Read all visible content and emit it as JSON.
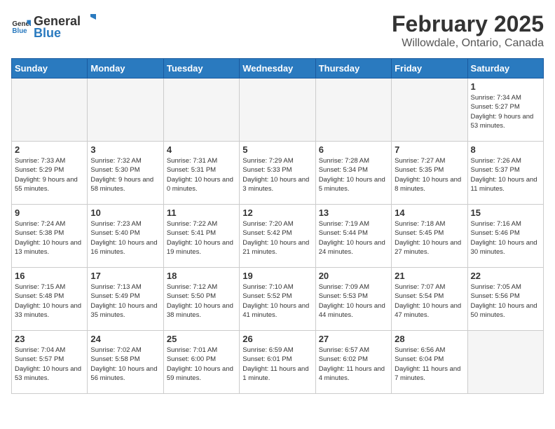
{
  "header": {
    "logo_general": "General",
    "logo_blue": "Blue",
    "title": "February 2025",
    "subtitle": "Willowdale, Ontario, Canada"
  },
  "weekdays": [
    "Sunday",
    "Monday",
    "Tuesday",
    "Wednesday",
    "Thursday",
    "Friday",
    "Saturday"
  ],
  "weeks": [
    [
      {
        "day": "",
        "info": ""
      },
      {
        "day": "",
        "info": ""
      },
      {
        "day": "",
        "info": ""
      },
      {
        "day": "",
        "info": ""
      },
      {
        "day": "",
        "info": ""
      },
      {
        "day": "",
        "info": ""
      },
      {
        "day": "1",
        "info": "Sunrise: 7:34 AM\nSunset: 5:27 PM\nDaylight: 9 hours and 53 minutes."
      }
    ],
    [
      {
        "day": "2",
        "info": "Sunrise: 7:33 AM\nSunset: 5:29 PM\nDaylight: 9 hours and 55 minutes."
      },
      {
        "day": "3",
        "info": "Sunrise: 7:32 AM\nSunset: 5:30 PM\nDaylight: 9 hours and 58 minutes."
      },
      {
        "day": "4",
        "info": "Sunrise: 7:31 AM\nSunset: 5:31 PM\nDaylight: 10 hours and 0 minutes."
      },
      {
        "day": "5",
        "info": "Sunrise: 7:29 AM\nSunset: 5:33 PM\nDaylight: 10 hours and 3 minutes."
      },
      {
        "day": "6",
        "info": "Sunrise: 7:28 AM\nSunset: 5:34 PM\nDaylight: 10 hours and 5 minutes."
      },
      {
        "day": "7",
        "info": "Sunrise: 7:27 AM\nSunset: 5:35 PM\nDaylight: 10 hours and 8 minutes."
      },
      {
        "day": "8",
        "info": "Sunrise: 7:26 AM\nSunset: 5:37 PM\nDaylight: 10 hours and 11 minutes."
      }
    ],
    [
      {
        "day": "9",
        "info": "Sunrise: 7:24 AM\nSunset: 5:38 PM\nDaylight: 10 hours and 13 minutes."
      },
      {
        "day": "10",
        "info": "Sunrise: 7:23 AM\nSunset: 5:40 PM\nDaylight: 10 hours and 16 minutes."
      },
      {
        "day": "11",
        "info": "Sunrise: 7:22 AM\nSunset: 5:41 PM\nDaylight: 10 hours and 19 minutes."
      },
      {
        "day": "12",
        "info": "Sunrise: 7:20 AM\nSunset: 5:42 PM\nDaylight: 10 hours and 21 minutes."
      },
      {
        "day": "13",
        "info": "Sunrise: 7:19 AM\nSunset: 5:44 PM\nDaylight: 10 hours and 24 minutes."
      },
      {
        "day": "14",
        "info": "Sunrise: 7:18 AM\nSunset: 5:45 PM\nDaylight: 10 hours and 27 minutes."
      },
      {
        "day": "15",
        "info": "Sunrise: 7:16 AM\nSunset: 5:46 PM\nDaylight: 10 hours and 30 minutes."
      }
    ],
    [
      {
        "day": "16",
        "info": "Sunrise: 7:15 AM\nSunset: 5:48 PM\nDaylight: 10 hours and 33 minutes."
      },
      {
        "day": "17",
        "info": "Sunrise: 7:13 AM\nSunset: 5:49 PM\nDaylight: 10 hours and 35 minutes."
      },
      {
        "day": "18",
        "info": "Sunrise: 7:12 AM\nSunset: 5:50 PM\nDaylight: 10 hours and 38 minutes."
      },
      {
        "day": "19",
        "info": "Sunrise: 7:10 AM\nSunset: 5:52 PM\nDaylight: 10 hours and 41 minutes."
      },
      {
        "day": "20",
        "info": "Sunrise: 7:09 AM\nSunset: 5:53 PM\nDaylight: 10 hours and 44 minutes."
      },
      {
        "day": "21",
        "info": "Sunrise: 7:07 AM\nSunset: 5:54 PM\nDaylight: 10 hours and 47 minutes."
      },
      {
        "day": "22",
        "info": "Sunrise: 7:05 AM\nSunset: 5:56 PM\nDaylight: 10 hours and 50 minutes."
      }
    ],
    [
      {
        "day": "23",
        "info": "Sunrise: 7:04 AM\nSunset: 5:57 PM\nDaylight: 10 hours and 53 minutes."
      },
      {
        "day": "24",
        "info": "Sunrise: 7:02 AM\nSunset: 5:58 PM\nDaylight: 10 hours and 56 minutes."
      },
      {
        "day": "25",
        "info": "Sunrise: 7:01 AM\nSunset: 6:00 PM\nDaylight: 10 hours and 59 minutes."
      },
      {
        "day": "26",
        "info": "Sunrise: 6:59 AM\nSunset: 6:01 PM\nDaylight: 11 hours and 1 minute."
      },
      {
        "day": "27",
        "info": "Sunrise: 6:57 AM\nSunset: 6:02 PM\nDaylight: 11 hours and 4 minutes."
      },
      {
        "day": "28",
        "info": "Sunrise: 6:56 AM\nSunset: 6:04 PM\nDaylight: 11 hours and 7 minutes."
      },
      {
        "day": "",
        "info": ""
      }
    ]
  ]
}
